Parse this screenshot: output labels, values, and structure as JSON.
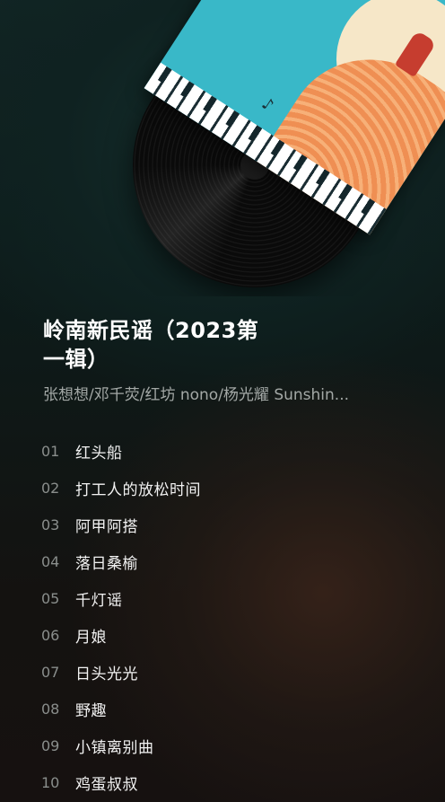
{
  "album": {
    "title": "岭南新民谣（2023第一辑）",
    "artists": "张想想/邓千荧/红坊 nono/杨光耀 Sunshin..."
  },
  "tracks": [
    {
      "no": "01",
      "title": "红头船"
    },
    {
      "no": "02",
      "title": "打工人的放松时间"
    },
    {
      "no": "03",
      "title": "阿甲阿搭"
    },
    {
      "no": "04",
      "title": "落日桑榆"
    },
    {
      "no": "05",
      "title": "千灯谣"
    },
    {
      "no": "06",
      "title": "月娘"
    },
    {
      "no": "07",
      "title": "日头光光"
    },
    {
      "no": "08",
      "title": "野趣"
    },
    {
      "no": "09",
      "title": "小镇离别曲"
    },
    {
      "no": "10",
      "title": "鸡蛋叔叔"
    }
  ],
  "colors": {
    "background": "#0b1413",
    "cover_teal": "#39b8c8",
    "cover_orange": "#ef8f53",
    "text_primary": "#ffffff",
    "text_secondary": "#a3a8a6",
    "track_number": "#8a8e8c"
  },
  "icons": [
    "vinyl-record",
    "album-cover-art"
  ]
}
